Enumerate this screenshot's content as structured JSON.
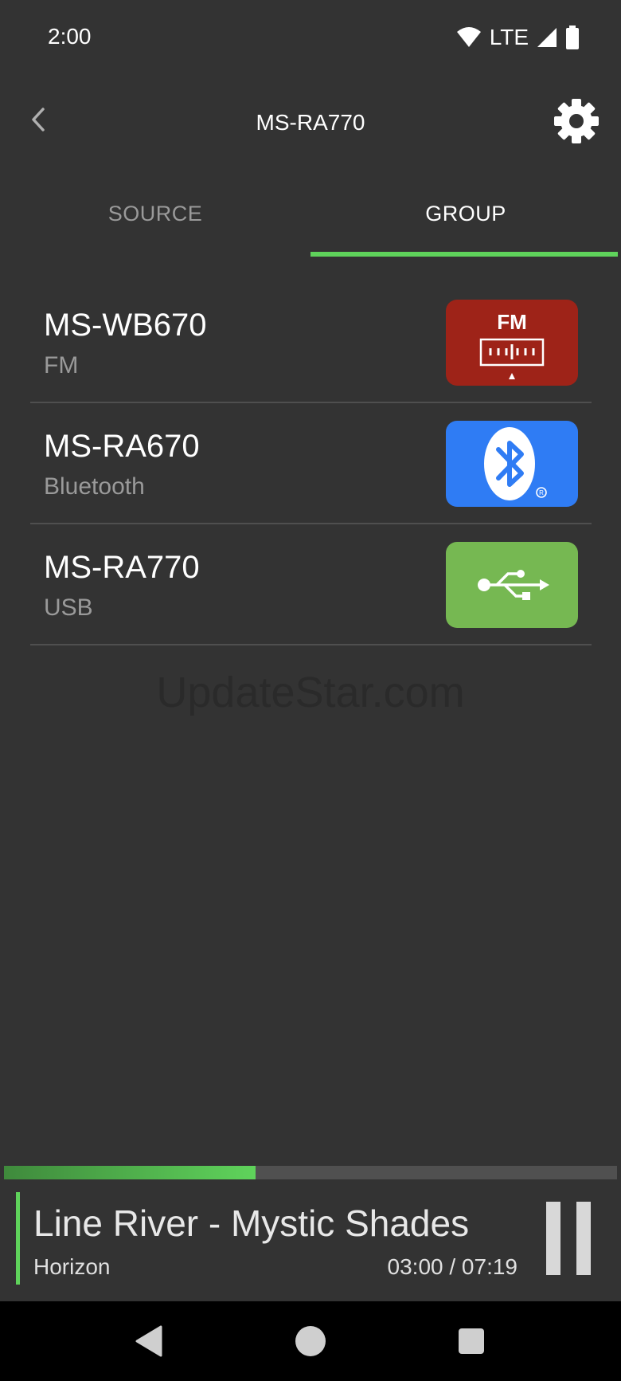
{
  "status_bar": {
    "time": "2:00",
    "network": "LTE",
    "icons": [
      "wifi-icon",
      "signal-icon",
      "battery-icon"
    ]
  },
  "app_bar": {
    "title": "MS-RA770",
    "back_icon": "chevron-left-icon",
    "settings_icon": "gear-icon"
  },
  "tabs": [
    {
      "label": "SOURCE",
      "active": false
    },
    {
      "label": "GROUP",
      "active": true
    }
  ],
  "devices": [
    {
      "name": "MS-WB670",
      "source": "FM",
      "badge_label": "FM",
      "badge_icon": "fm-radio-icon",
      "badge_color": "#9e2318"
    },
    {
      "name": "MS-RA670",
      "source": "Bluetooth",
      "badge_icon": "bluetooth-icon",
      "badge_color": "#2f7cf4"
    },
    {
      "name": "MS-RA770",
      "source": "USB",
      "badge_icon": "usb-icon",
      "badge_color": "#76b852"
    }
  ],
  "watermark": "UpdateStar.com",
  "player": {
    "title": "Line River - Mystic Shades",
    "artist": "Horizon",
    "time": "03:00 / 07:19",
    "progress_fraction": 0.41,
    "pause_icon": "pause-icon"
  },
  "nav_bar": {
    "icons": [
      "back-triangle-icon",
      "home-circle-icon",
      "recents-square-icon"
    ]
  },
  "colors": {
    "background": "#333333",
    "accent": "#5fd35b",
    "muted_text": "#9a9a9a"
  }
}
